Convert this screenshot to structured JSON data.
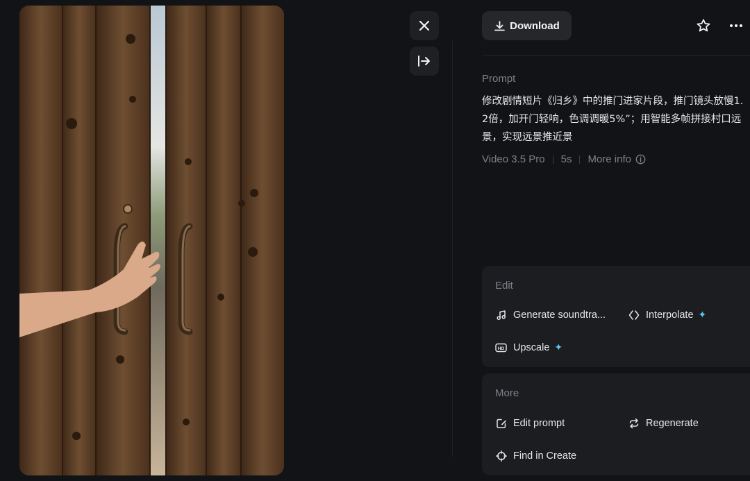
{
  "toolbar": {
    "download_label": "Download",
    "close_icon": "close-icon",
    "collapse_icon": "collapse-right-icon",
    "favorite_icon": "star-icon",
    "more_icon": "more-horizontal-icon"
  },
  "prompt": {
    "label": "Prompt",
    "text": "修改剧情短片《归乡》中的推门进家片段，推门镜头放慢1.2倍，加开门轻响，色调调暖5%”；用智能多帧拼接村口远景，实现远景推近景"
  },
  "meta": {
    "model": "Video 3.5 Pro",
    "duration": "5s",
    "more_info": "More info"
  },
  "edit_panel": {
    "title": "Edit",
    "actions": [
      {
        "label": "Generate soundtra...",
        "icon": "music-note-icon",
        "premium": false
      },
      {
        "label": "Interpolate",
        "icon": "interpolate-icon",
        "premium": true
      },
      {
        "label": "Upscale",
        "icon": "hd-icon",
        "premium": true
      }
    ]
  },
  "more_panel": {
    "title": "More",
    "actions": [
      {
        "label": "Edit prompt",
        "icon": "edit-icon"
      },
      {
        "label": "Regenerate",
        "icon": "regenerate-icon"
      },
      {
        "label": "Find in Create",
        "icon": "crosshair-icon"
      }
    ]
  },
  "colors": {
    "background": "#121316",
    "panel": "#1c1d21",
    "button": "#25272b",
    "accent_sparkle": "#5bc8f0",
    "muted_text": "#7e8187"
  }
}
